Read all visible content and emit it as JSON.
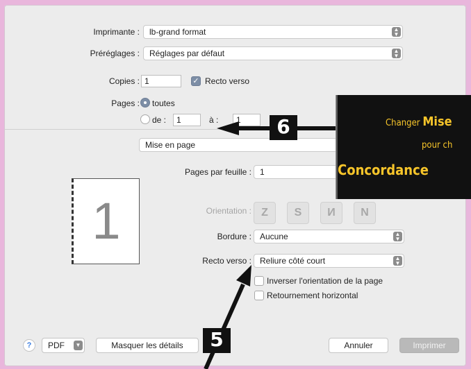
{
  "printer": {
    "label": "Imprimante :",
    "value": "lb-grand format"
  },
  "presets": {
    "label": "Préréglages :",
    "value": "Réglages par défaut"
  },
  "copies": {
    "label": "Copies :",
    "value": "1",
    "duplex_label": "Recto verso"
  },
  "pages": {
    "label": "Pages :",
    "all_label": "toutes",
    "from_label": "de :",
    "from_value": "1",
    "to_label": "à :",
    "to_value": "1"
  },
  "section_popup": {
    "value": "Mise en page"
  },
  "layout": {
    "pages_per_sheet_label": "Pages par feuille :",
    "pages_per_sheet_value": "1",
    "orientation_label": "Orientation :",
    "border_label": "Bordure :",
    "border_value": "Aucune",
    "duplex_label": "Recto verso :",
    "duplex_value": "Reliure côté court",
    "reverse_label": "Inverser l'orientation de la page",
    "flip_label": "Retournement horizontal"
  },
  "preview": {
    "page_number": "1"
  },
  "footer": {
    "help": "?",
    "pdf": "PDF",
    "details": "Masquer les détails",
    "cancel": "Annuler",
    "print": "Imprimer"
  },
  "annotations": {
    "callout_line1_prefix": "Changer ",
    "callout_line1_bold": "Mise",
    "callout_line2": "pour ch",
    "callout_line3": "Concordance",
    "step5": "5",
    "step6": "6"
  },
  "colors": {
    "background": "#e9b6dc",
    "callout_text": "#f7c52a",
    "checkbox_on": "#7d8ea6"
  }
}
